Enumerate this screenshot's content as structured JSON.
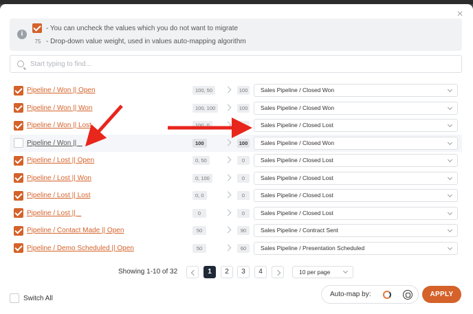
{
  "info": {
    "line1": "-  You can uncheck the values which you do not want to migrate",
    "line2_badge": "75",
    "line2": "-  Drop-down value weight, used in values auto-mapping algorithm"
  },
  "search": {
    "placeholder": "Start typing to find..."
  },
  "rows": [
    {
      "checked": true,
      "name": "Pipeline / Won || Open",
      "weights": "100, 50",
      "target_weight": "100",
      "target": "Sales Pipeline / Closed Won"
    },
    {
      "checked": true,
      "name": "Pipeline / Won || Won",
      "weights": "100, 100",
      "target_weight": "100",
      "target": "Sales Pipeline / Closed Won"
    },
    {
      "checked": true,
      "name": "Pipeline / Won || Lost",
      "weights": "100, 0",
      "target_weight": "0",
      "target": "Sales Pipeline / Closed Lost"
    },
    {
      "checked": false,
      "name": "Pipeline / Won || _",
      "weights": "100",
      "target_weight": "100",
      "target": "Sales Pipeline / Closed Won"
    },
    {
      "checked": true,
      "name": "Pipeline / Lost || Open",
      "weights": "0, 50",
      "target_weight": "0",
      "target": "Sales Pipeline / Closed Lost"
    },
    {
      "checked": true,
      "name": "Pipeline / Lost || Won",
      "weights": "0, 100",
      "target_weight": "0",
      "target": "Sales Pipeline / Closed Lost"
    },
    {
      "checked": true,
      "name": "Pipeline / Lost || Lost",
      "weights": "0, 0",
      "target_weight": "0",
      "target": "Sales Pipeline / Closed Lost"
    },
    {
      "checked": true,
      "name": "Pipeline / Lost || _",
      "weights": "0",
      "target_weight": "0",
      "target": "Sales Pipeline / Closed Lost"
    },
    {
      "checked": true,
      "name": "Pipeline / Contact Made || Open",
      "weights": "50",
      "target_weight": "90",
      "target": "Sales Pipeline / Contract Sent"
    },
    {
      "checked": true,
      "name": "Pipeline / Demo Scheduled || Open",
      "weights": "50",
      "target_weight": "60",
      "target": "Sales Pipeline / Presentation Scheduled"
    }
  ],
  "pagination": {
    "summary": "Showing 1-10 of 32",
    "pages": [
      "1",
      "2",
      "3",
      "4"
    ],
    "active_page": "1",
    "per_page": "10 per page"
  },
  "footer": {
    "switch_all": "Switch All",
    "automap_label": "Auto-map by:",
    "apply": "APPLY"
  },
  "colors": {
    "accent": "#d4622a",
    "annotation_arrow": "#e8261c"
  }
}
